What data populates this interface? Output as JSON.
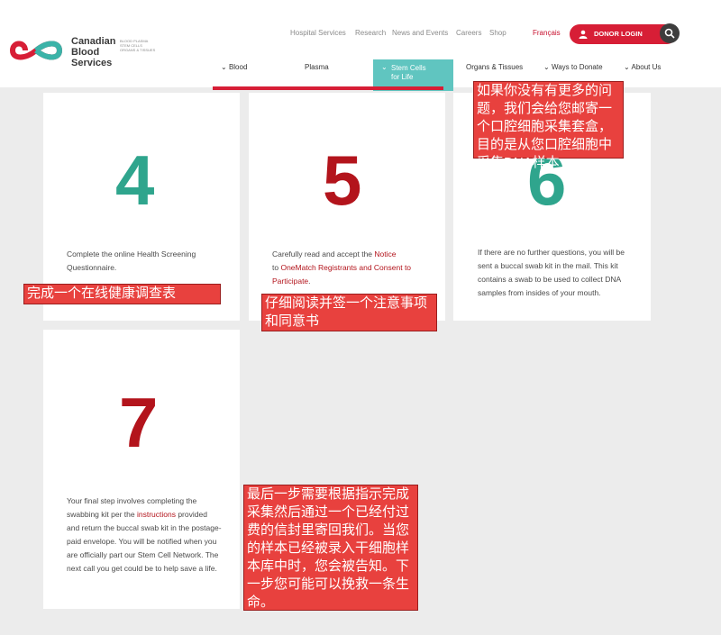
{
  "logo": {
    "line1": "Canadian",
    "line2": "Blood",
    "line3": "Services",
    "sub": "BLOOD PLASMA STEM CELLS ORGANS & TISSUES"
  },
  "util_nav": [
    "Hospital Services",
    "Research",
    "News and Events",
    "Careers",
    "Shop"
  ],
  "francais": "Français",
  "donor_login": "DONOR LOGIN",
  "main_nav": {
    "blood": "Blood",
    "plasma": "Plasma",
    "stem_line1": "Stem Cells",
    "stem_line2": "for Life",
    "organs": "Organs & Tissues",
    "ways": "Ways to Donate",
    "about": "About Us"
  },
  "steps": [
    {
      "number": "4",
      "text": "Complete the online Health Screening Questionnaire.",
      "annotation": "完成一个在线健康调查表"
    },
    {
      "number": "5",
      "text_pre": "Carefully read and accept the ",
      "link1": "Notice",
      "text_mid": "to ",
      "link2": "OneMatch Registrants and Consent to Participate",
      "text_post": ".",
      "annotation": "仔细阅读并签一个注意事项和同意书"
    },
    {
      "number": "6",
      "text": "If there are no further questions, you will be sent a buccal swab kit in the mail. This kit contains a swab to be used to collect DNA samples from insides of your mouth.",
      "annotation": "如果你没有有更多的问题，我们会给您邮寄一个口腔细胞采集套盒，目的是从您口腔细胞中采集DNA样本"
    },
    {
      "number": "7",
      "text_pre": "Your final step involves completing the swabbing kit per the ",
      "link": "instructions",
      "text_post": " provided and return the buccal swab kit in the postage-paid envelope. You will be notified when you are officially part our Stem Cell Network. The next call you get could be to help save a life.",
      "annotation": "最后一步需要根据指示完成采集然后通过一个已经付过费的信封里寄回我们。当您的样本已经被录入干细胞样本库中时，您会被告知。下一步您可能可以挽救一条生命。"
    }
  ]
}
